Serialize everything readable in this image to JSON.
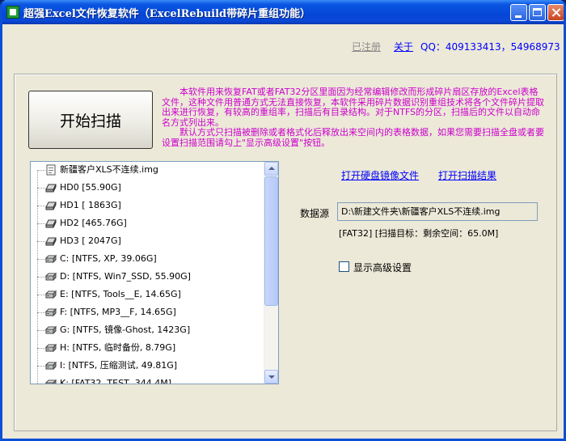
{
  "window": {
    "title": "超强Excel文件恢复软件（ExcelRebuild带碎片重组功能）"
  },
  "header": {
    "registered": "已注册",
    "about": "关于",
    "qq": "QQ：409133413，54968973"
  },
  "start_button": "开始扫描",
  "description": {
    "p1": "本软件用来恢复FAT或者FAT32分区里面因为经常编辑修改而形成碎片扇区存放的Excel表格文件，这种文件用普通方式无法直接恢复，本软件采用碎片数据识别重组技术将各个文件碎片提取出来进行恢复，有较高的重组率，扫描后有目录结构。对于NTFS的分区，扫描后的文件以自动命名方式列出来。",
    "p2": "默认方式只扫描被删除或者格式化后释放出来空间内的表格数据，如果您需要扫描全盘或者要设置扫描范围请勾上\"显示高级设置\"按钮。"
  },
  "tree": {
    "items": [
      {
        "label": "新疆客户XLS不连续.img",
        "icon": "file-icon"
      },
      {
        "label": "HD0 [55.90G]",
        "icon": "hard-disk-icon"
      },
      {
        "label": "HD1 [ 1863G]",
        "icon": "hard-disk-icon"
      },
      {
        "label": "HD2 [465.76G]",
        "icon": "hard-disk-icon"
      },
      {
        "label": "HD3 [ 2047G]",
        "icon": "hard-disk-icon"
      },
      {
        "label": "C:  [NTFS, XP, 39.06G]",
        "icon": "drive-icon"
      },
      {
        "label": "D:  [NTFS, Win7_SSD, 55.90G]",
        "icon": "drive-icon"
      },
      {
        "label": "E:  [NTFS, Tools__E, 14.65G]",
        "icon": "drive-icon"
      },
      {
        "label": "F:  [NTFS, MP3__F, 14.65G]",
        "icon": "drive-icon"
      },
      {
        "label": "G:  [NTFS, 镜像-Ghost, 1423G]",
        "icon": "drive-icon"
      },
      {
        "label": "H:  [NTFS, 临时备份, 8.79G]",
        "icon": "drive-icon"
      },
      {
        "label": "I:  [NTFS, 压缩测试, 49.81G]",
        "icon": "drive-icon"
      },
      {
        "label": "K:  [FAT32, TEST, 344.4M]",
        "icon": "drive-icon"
      }
    ]
  },
  "links": {
    "open_image": "打开硬盘镜像文件",
    "open_result": "打开扫描结果"
  },
  "datasource": {
    "label": "数据源",
    "value": "D:\\新建文件夹\\新疆客户XLS不连续.img"
  },
  "scan_info": "[FAT32] [扫描目标：剩余空间：65.0M]",
  "advanced": {
    "label": "显示高级设置",
    "checked": false
  }
}
